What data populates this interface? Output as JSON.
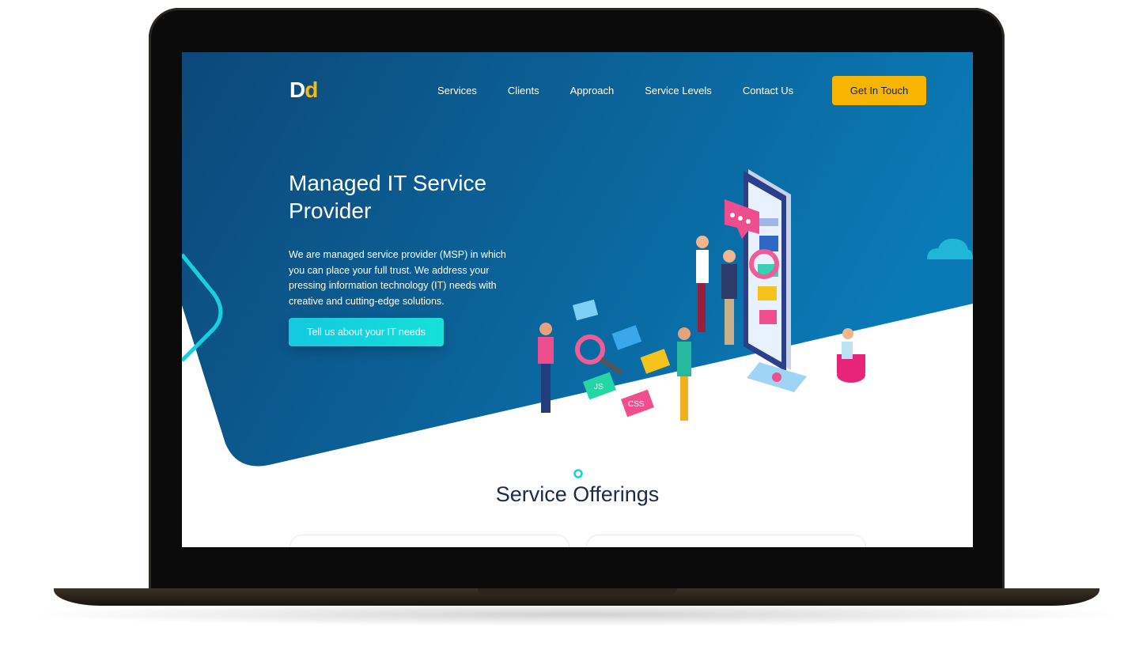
{
  "logo": {
    "part1": "D",
    "part2": "d"
  },
  "nav": {
    "items": [
      "Services",
      "Clients",
      "Approach",
      "Service Levels",
      "Contact Us"
    ],
    "cta_label": "Get In Touch"
  },
  "hero": {
    "title": "Managed IT Service Provider",
    "description": "We are managed service provider (MSP) in which you can place your full trust. We address your pressing information technology (IT) needs with creative and cutting-edge solutions.",
    "button_label": "Tell us about your IT needs"
  },
  "sections": {
    "offerings_title": "Service Offerings"
  },
  "illustration": {
    "tile_js": "JS",
    "tile_css": "CSS"
  },
  "colors": {
    "hero_dark": "#0b4e86",
    "hero_light": "#0a79b6",
    "accent_yellow": "#f7b400",
    "accent_cyan": "#15d2dc"
  }
}
